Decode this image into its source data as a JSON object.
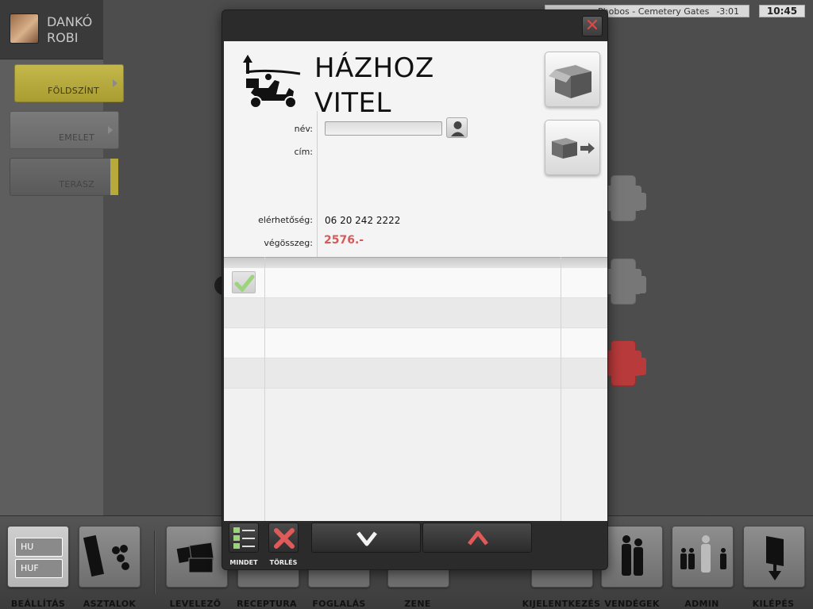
{
  "user": {
    "name": "DANKÓ ROBI"
  },
  "floors": [
    {
      "label": "FÖLDSZÍNT"
    },
    {
      "label": "EMELET"
    },
    {
      "label": "TERASZ"
    }
  ],
  "status": {
    "track": "Phobos - Cemetery Gates",
    "time_left": "-3:01",
    "clock": "10:45"
  },
  "toolbar": {
    "items": [
      {
        "label": "BEÁLLÍTÁS",
        "icon": "settings-icon"
      },
      {
        "label": "ASZTALOK",
        "icon": "tables-icon"
      },
      {
        "label": "LEVELEZŐ",
        "icon": "mail-icon"
      },
      {
        "label": "RECEPTURA",
        "icon": "recipe-icon"
      },
      {
        "label": "FOGLALÁS",
        "icon": "booking-icon"
      },
      {
        "label": "ZENE",
        "icon": "music-icon"
      },
      {
        "label": "KIJELENTKEZÉS",
        "icon": "logout-icon"
      },
      {
        "label": "VENDÉGEK",
        "icon": "guests-icon"
      },
      {
        "label": "ADMIN",
        "icon": "admin-icon"
      },
      {
        "label": "KILÉPÉS",
        "icon": "exit-icon"
      }
    ],
    "settings": {
      "lang": "HU",
      "currency": "HUF"
    }
  },
  "modal": {
    "title_line1": "HÁZHOZ",
    "title_line2": "VITEL",
    "labels": {
      "name": "név:",
      "address": "cím:",
      "contact": "elérhetőség:",
      "total": "végösszeg:"
    },
    "values": {
      "name": "",
      "contact": "06 20 242 2222",
      "total": "2576.-"
    },
    "buttons": {
      "select_all": "MINDET",
      "delete": "TÖRLÉS"
    },
    "colors": {
      "total": "#d75a5a",
      "check": "#9bd47a",
      "delete": "#e05a5a",
      "up": "#e05a5a"
    }
  }
}
